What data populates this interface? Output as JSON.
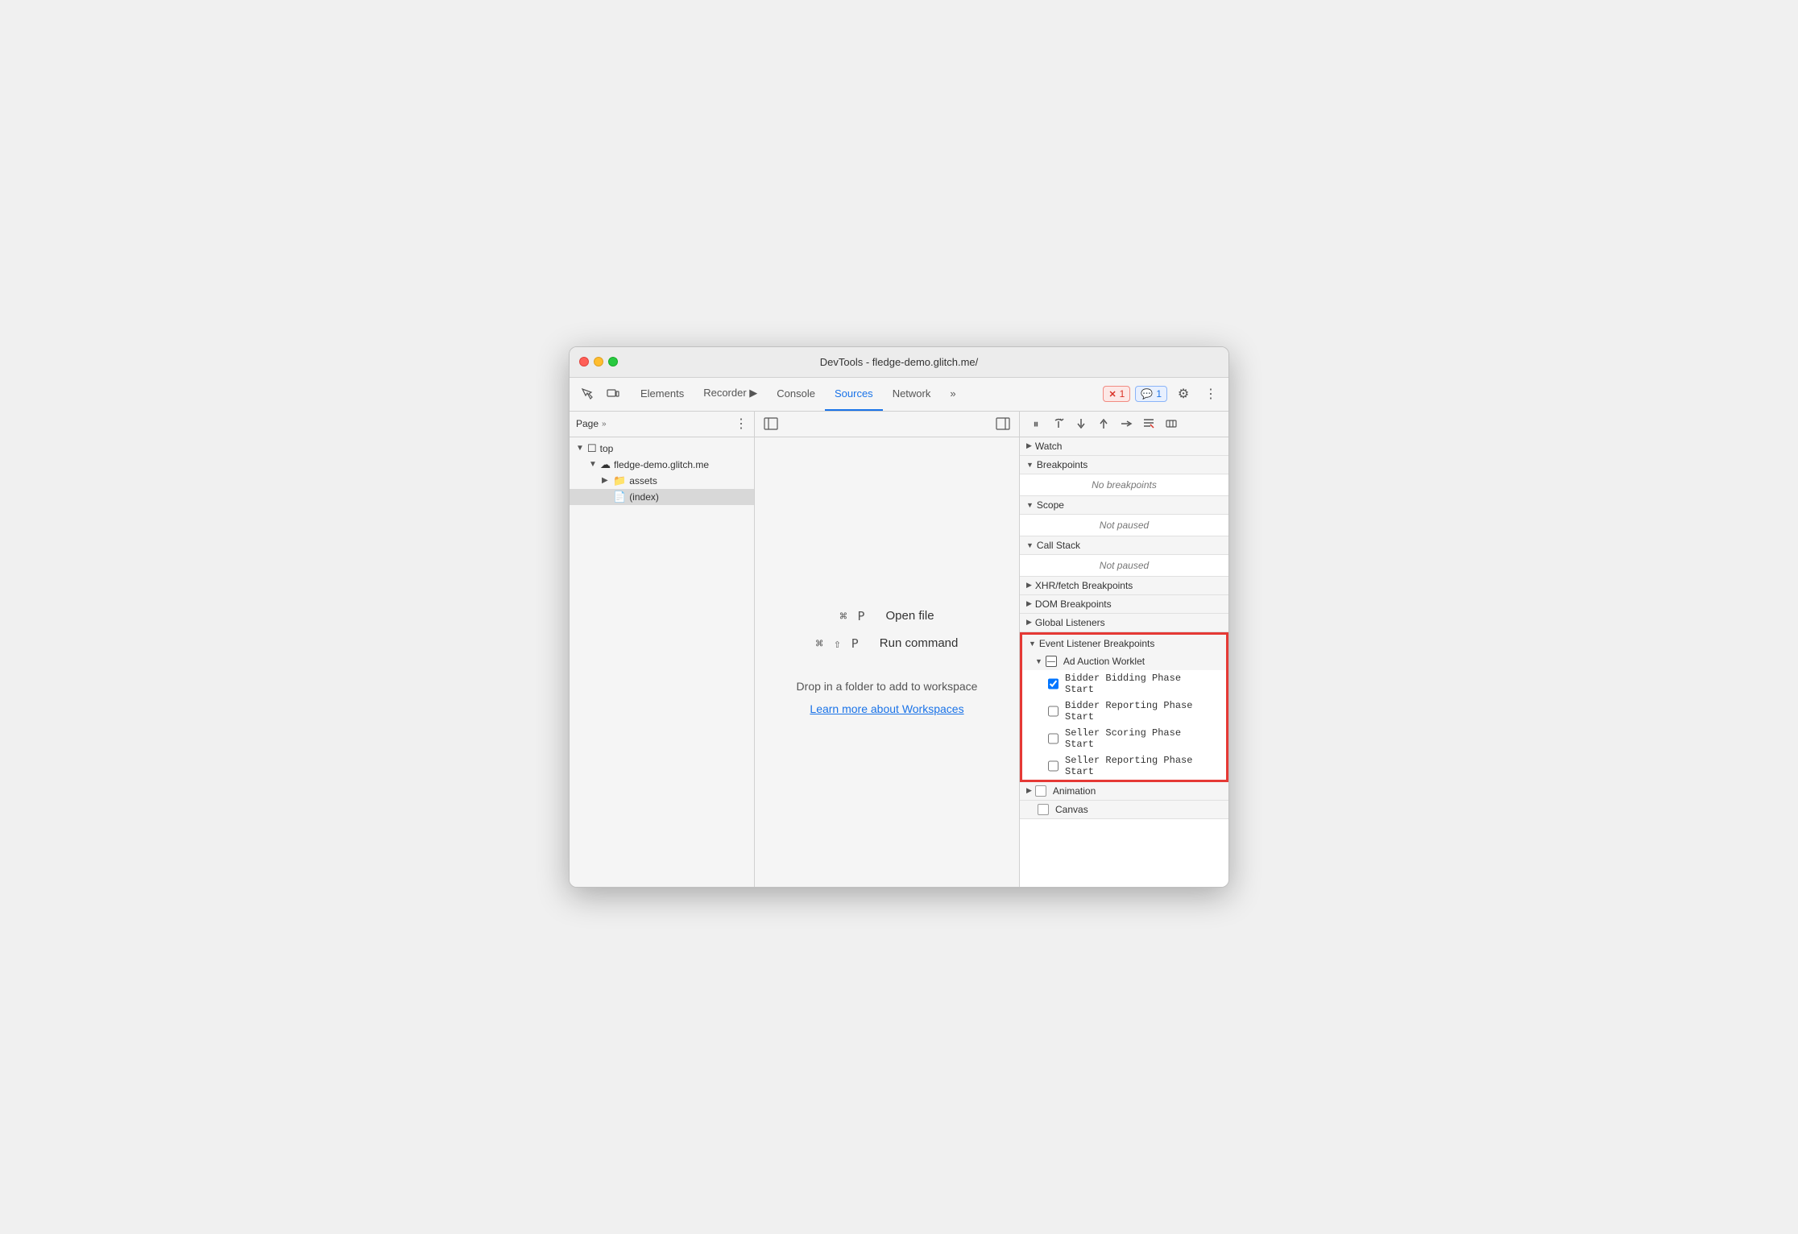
{
  "window": {
    "title": "DevTools - fledge-demo.glitch.me/"
  },
  "traffic_lights": {
    "red": "close",
    "yellow": "minimize",
    "green": "maximize"
  },
  "tabs": {
    "items": [
      {
        "label": "Elements",
        "active": false
      },
      {
        "label": "Recorder 🎬",
        "active": false
      },
      {
        "label": "Console",
        "active": false
      },
      {
        "label": "Sources",
        "active": true
      },
      {
        "label": "Network",
        "active": false
      }
    ],
    "more_label": "»"
  },
  "badges": {
    "error": {
      "icon": "✕",
      "count": "1"
    },
    "info": {
      "icon": "💬",
      "count": "1"
    }
  },
  "left_panel": {
    "header_title": "Page",
    "tree": [
      {
        "level": 0,
        "arrow": "▼",
        "icon": "☐",
        "label": "top",
        "indent": 0
      },
      {
        "level": 1,
        "arrow": "▼",
        "icon": "☁",
        "label": "fledge-demo.glitch.me",
        "indent": 16
      },
      {
        "level": 2,
        "arrow": "▶",
        "icon": "📁",
        "label": "assets",
        "indent": 32
      },
      {
        "level": 2,
        "arrow": "",
        "icon": "📄",
        "label": "(index)",
        "indent": 32,
        "selected": true
      }
    ]
  },
  "center_panel": {
    "shortcut1_keys": "⌘ P",
    "shortcut1_label": "Open file",
    "shortcut2_keys": "⌘ ⇧ P",
    "shortcut2_label": "Run command",
    "drop_text": "Drop in a folder to add to workspace",
    "learn_link": "Learn more about Workspaces"
  },
  "right_panel": {
    "sections": [
      {
        "id": "watch",
        "arrow": "▶",
        "label": "Watch",
        "collapsed": true
      },
      {
        "id": "breakpoints",
        "arrow": "▼",
        "label": "Breakpoints",
        "empty_text": "No breakpoints"
      },
      {
        "id": "scope",
        "arrow": "▼",
        "label": "Scope",
        "empty_text": "Not paused"
      },
      {
        "id": "call-stack",
        "arrow": "▼",
        "label": "Call Stack",
        "empty_text": "Not paused"
      },
      {
        "id": "xhr-breakpoints",
        "arrow": "▶",
        "label": "XHR/fetch Breakpoints",
        "collapsed": true
      },
      {
        "id": "dom-breakpoints",
        "arrow": "▶",
        "label": "DOM Breakpoints",
        "collapsed": true
      },
      {
        "id": "global-listeners",
        "arrow": "▶",
        "label": "Global Listeners",
        "collapsed": true
      },
      {
        "id": "event-listener-breakpoints",
        "arrow": "▼",
        "label": "Event Listener Breakpoints",
        "highlighted": true,
        "subsections": [
          {
            "id": "ad-auction-worklet",
            "arrow": "▼",
            "icon": "minus",
            "label": "Ad Auction Worklet",
            "items": [
              {
                "label": "Bidder Bidding Phase Start",
                "checked": true
              },
              {
                "label": "Bidder Reporting Phase Start",
                "checked": false
              },
              {
                "label": "Seller Scoring Phase Start",
                "checked": false
              },
              {
                "label": "Seller Reporting Phase Start",
                "checked": false
              }
            ]
          }
        ]
      }
    ],
    "animation_section": {
      "arrow": "▶",
      "icon": "☐",
      "label": "Animation"
    },
    "canvas_section": {
      "arrow": "",
      "icon": "☐",
      "label": "Canvas"
    }
  },
  "debug_buttons": [
    {
      "name": "pause",
      "icon": "⏸"
    },
    {
      "name": "step-over",
      "icon": "↷"
    },
    {
      "name": "step-into",
      "icon": "↓"
    },
    {
      "name": "step-out",
      "icon": "↑"
    },
    {
      "name": "step",
      "icon": "↦"
    },
    {
      "name": "deactivate-breakpoints",
      "icon": "✏"
    },
    {
      "name": "pause-on-exceptions",
      "icon": "⏸"
    }
  ]
}
